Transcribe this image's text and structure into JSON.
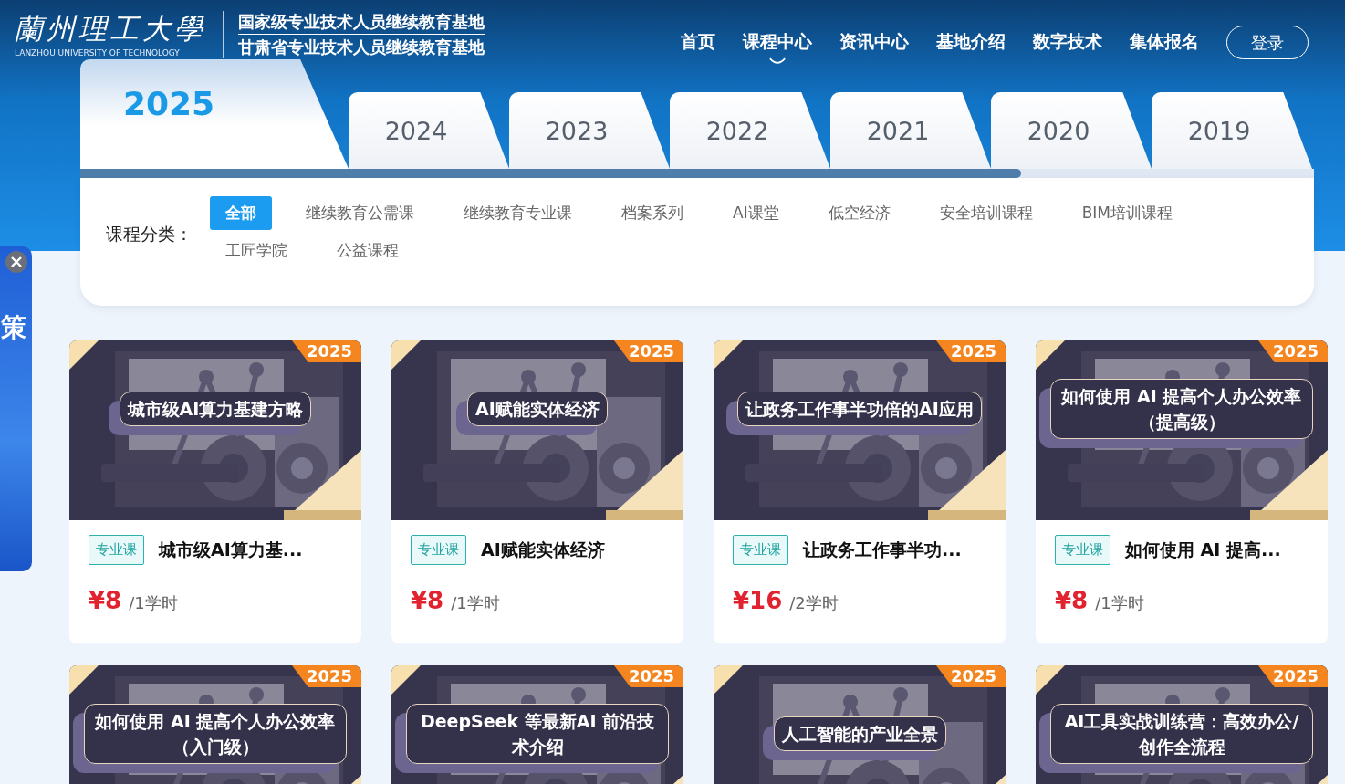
{
  "logo": {
    "name": "蘭州理工大學",
    "subtitle": "LANZHOU UNIVERSITY OF TECHNOLOGY",
    "lines": [
      "国家级专业技术人员继续教育基地",
      "甘肃省专业技术人员继续教育基地"
    ]
  },
  "nav": [
    {
      "label": "首页",
      "selected": false
    },
    {
      "label": "课程中心",
      "selected": true
    },
    {
      "label": "资讯中心",
      "selected": false
    },
    {
      "label": "基地介绍",
      "selected": false
    },
    {
      "label": "数字技术",
      "selected": false
    },
    {
      "label": "集体报名",
      "selected": false
    }
  ],
  "login_button": "登录",
  "year_tabs": [
    {
      "label": "2025",
      "selected": true
    },
    {
      "label": "2024",
      "selected": false
    },
    {
      "label": "2023",
      "selected": false
    },
    {
      "label": "2022",
      "selected": false
    },
    {
      "label": "2021",
      "selected": false
    },
    {
      "label": "2020",
      "selected": false
    },
    {
      "label": "2019",
      "selected": false
    }
  ],
  "category_label": "课程分类：",
  "categories": [
    {
      "label": "全部",
      "selected": true
    },
    {
      "label": "继续教育公需课",
      "selected": false
    },
    {
      "label": "继续教育专业课",
      "selected": false
    },
    {
      "label": "档案系列",
      "selected": false
    },
    {
      "label": "AI课堂",
      "selected": false
    },
    {
      "label": "低空经济",
      "selected": false
    },
    {
      "label": "安全培训课程",
      "selected": false
    },
    {
      "label": "BIM培训课程",
      "selected": false
    },
    {
      "label": "工匠学院",
      "selected": false
    },
    {
      "label": "公益课程",
      "selected": false
    }
  ],
  "side_panel": {
    "text": "策"
  },
  "courses": [
    {
      "badge": "2025",
      "thumb_title": "城市级AI算力基建方略",
      "tag": "专业课",
      "title": "城市级AI算力基...",
      "price": "¥8",
      "unit": "/1学时"
    },
    {
      "badge": "2025",
      "thumb_title": "AI赋能实体经济",
      "tag": "专业课",
      "title": "AI赋能实体经济",
      "price": "¥8",
      "unit": "/1学时"
    },
    {
      "badge": "2025",
      "thumb_title": "让政务工作事半功倍的AI应用",
      "tag": "专业课",
      "title": "让政务工作事半功...",
      "price": "¥16",
      "unit": "/2学时"
    },
    {
      "badge": "2025",
      "thumb_title": "如何使用 AI 提高个人办公效率（提高级）",
      "tag": "专业课",
      "title": "如何使用 AI 提高...",
      "price": "¥8",
      "unit": "/1学时"
    },
    {
      "badge": "2025",
      "thumb_title": "如何使用 AI 提高个人办公效率（入门级）"
    },
    {
      "badge": "2025",
      "thumb_title": "DeepSeek 等最新AI 前沿技术介绍"
    },
    {
      "badge": "2025",
      "thumb_title": "人工智能的产业全景"
    },
    {
      "badge": "2025",
      "thumb_title": "AI工具实战训练营：高效办公/创作全流程"
    }
  ]
}
